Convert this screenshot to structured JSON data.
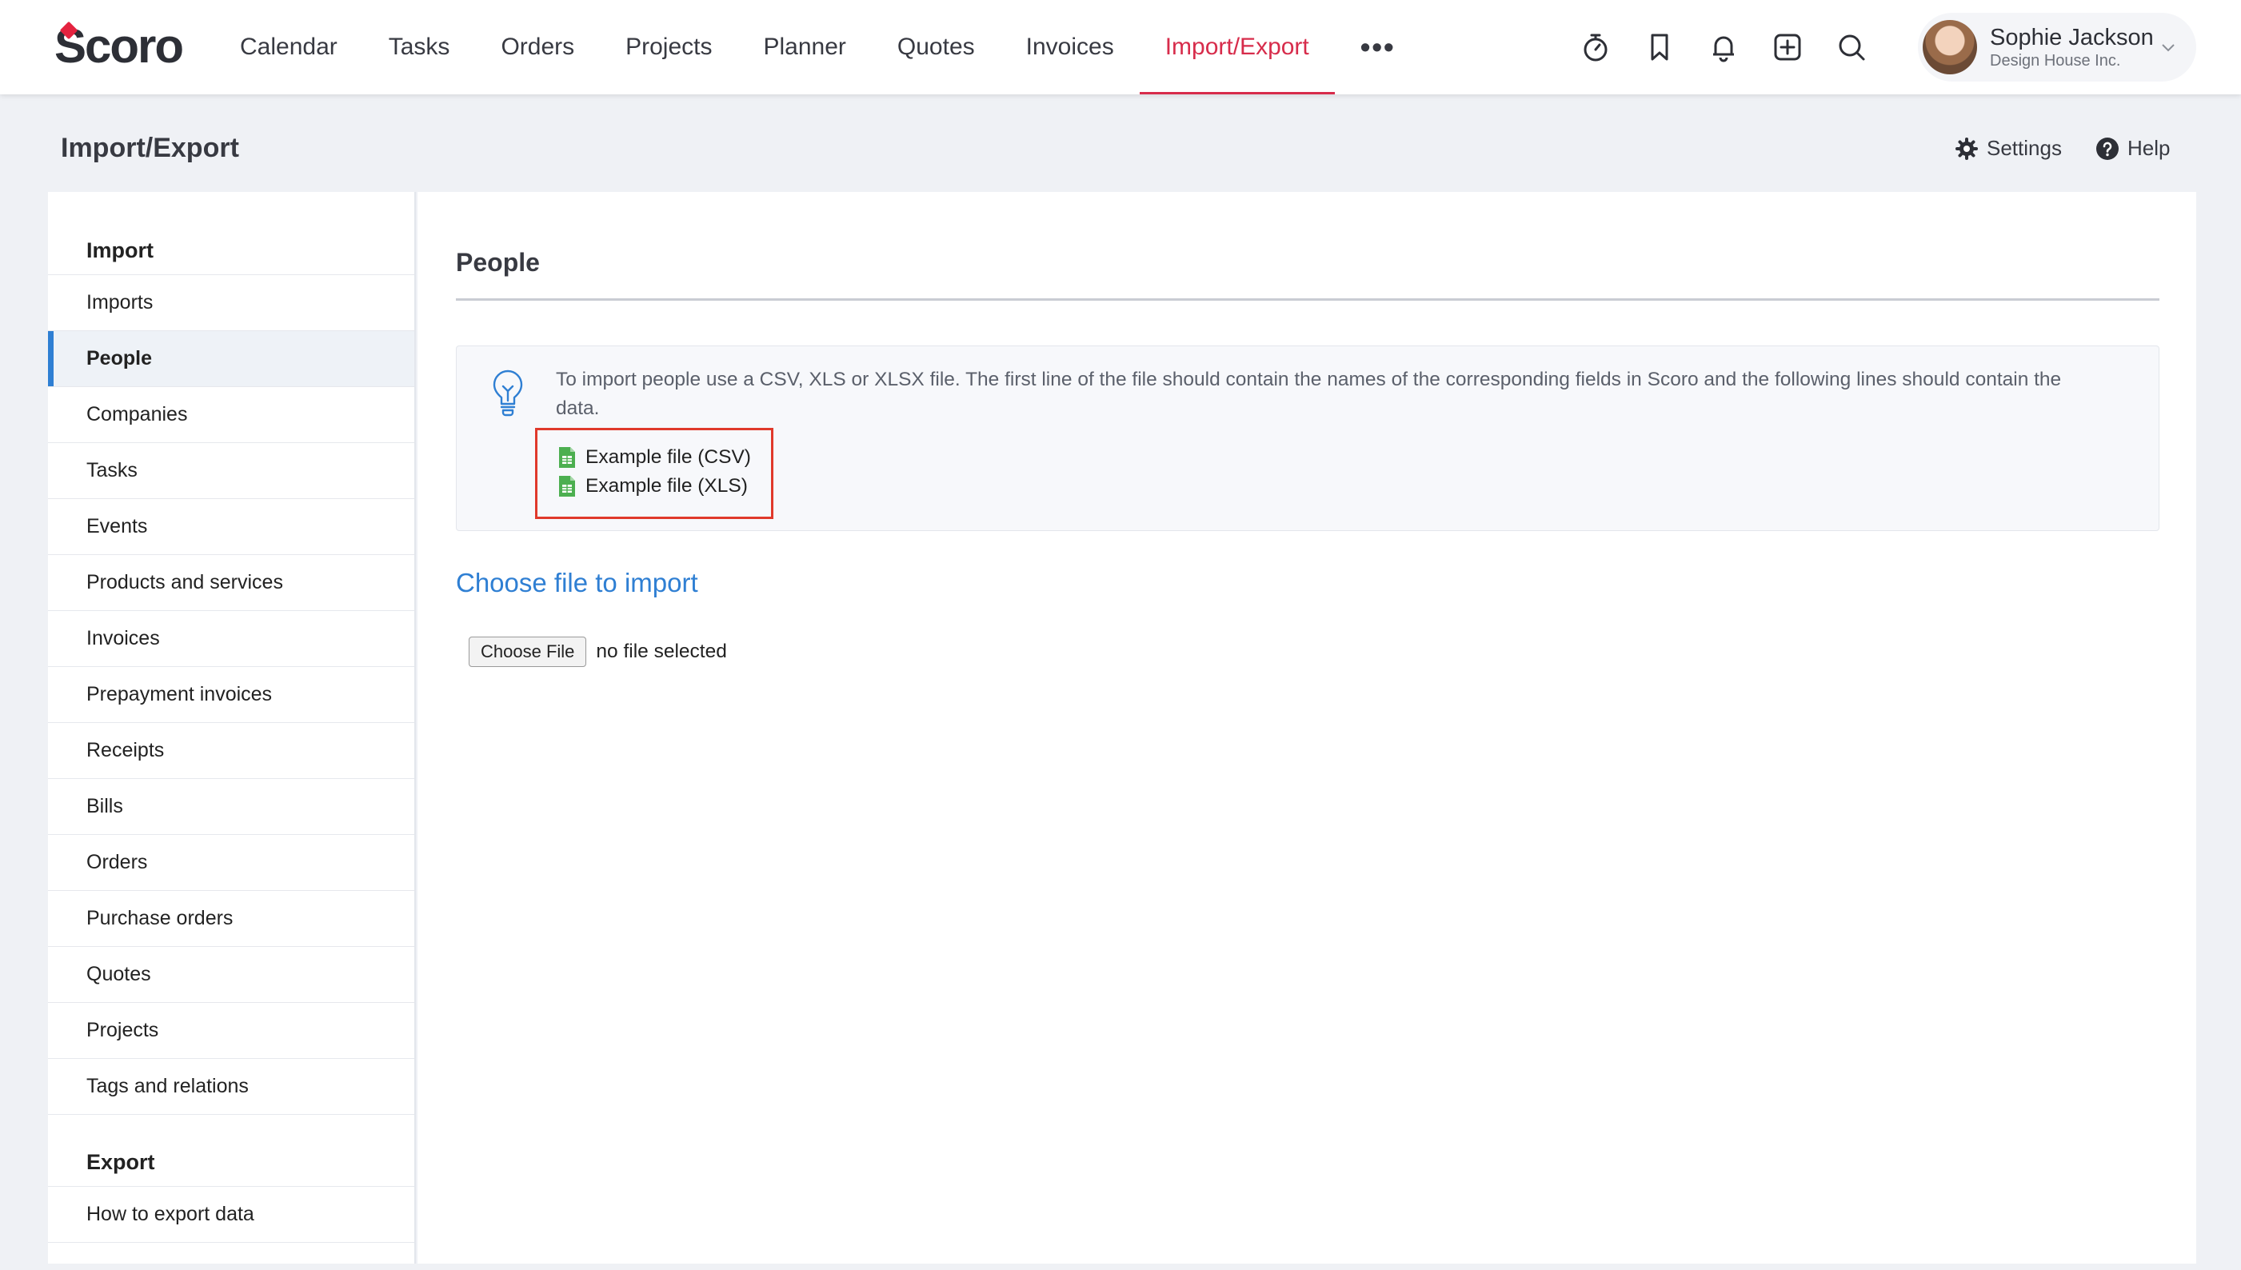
{
  "brand": {
    "logo_text": "Scoro",
    "accent": "#d72c4b",
    "link_color": "#2f7fd3",
    "highlight_box": "#e0392b"
  },
  "nav": {
    "items": [
      {
        "label": "Calendar"
      },
      {
        "label": "Tasks"
      },
      {
        "label": "Orders"
      },
      {
        "label": "Projects"
      },
      {
        "label": "Planner"
      },
      {
        "label": "Quotes"
      },
      {
        "label": "Invoices"
      },
      {
        "label": "Import/Export",
        "active": true
      }
    ],
    "more_label": "•••"
  },
  "toolbar_icons": [
    "timer-icon",
    "bookmark-icon",
    "bell-icon",
    "add-icon",
    "search-icon"
  ],
  "user": {
    "name": "Sophie Jackson",
    "company": "Design House Inc."
  },
  "page": {
    "title": "Import/Export",
    "settings_label": "Settings",
    "help_label": "Help"
  },
  "sidebar": {
    "import_heading": "Import",
    "import_items": [
      {
        "label": "Imports"
      },
      {
        "label": "People",
        "active": true
      },
      {
        "label": "Companies"
      },
      {
        "label": "Tasks"
      },
      {
        "label": "Events"
      },
      {
        "label": "Products and services"
      },
      {
        "label": "Invoices"
      },
      {
        "label": "Prepayment invoices"
      },
      {
        "label": "Receipts"
      },
      {
        "label": "Bills"
      },
      {
        "label": "Orders"
      },
      {
        "label": "Purchase orders"
      },
      {
        "label": "Quotes"
      },
      {
        "label": "Projects"
      },
      {
        "label": "Tags and relations"
      }
    ],
    "export_heading": "Export",
    "export_items": [
      {
        "label": "How to export data"
      }
    ]
  },
  "main": {
    "section_title": "People",
    "info_text": "To import people use a CSV, XLS or XLSX file. The first line of the file should contain the names of the corresponding fields in Scoro and the following lines should contain the data.",
    "example_csv": "Example file (CSV)",
    "example_xls": "Example file (XLS)",
    "choose_title": "Choose file to import",
    "choose_button": "Choose File",
    "file_status": "no file selected"
  }
}
